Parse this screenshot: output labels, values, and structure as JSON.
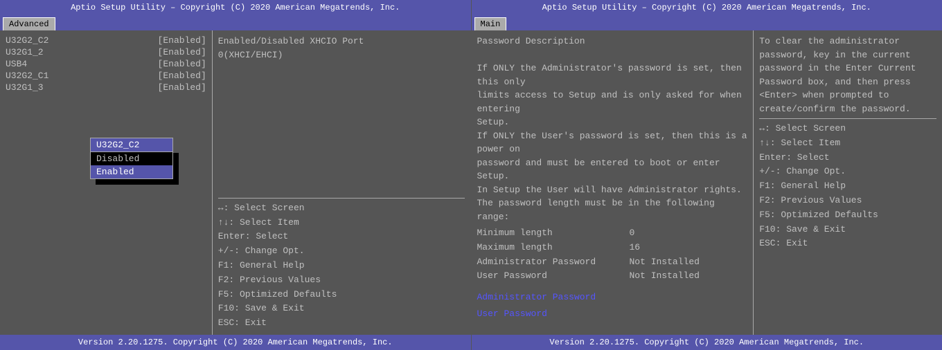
{
  "left_panel": {
    "top_bar": "Aptio Setup Utility – Copyright (C) 2020 American Megatrends, Inc.",
    "active_tab": "Advanced",
    "tabs": [
      "Advanced"
    ],
    "menu_items": [
      {
        "name": "U32G2_C2",
        "value": "[Enabled]"
      },
      {
        "name": "U32G1_2",
        "value": "[Enabled]"
      },
      {
        "name": "USB4",
        "value": "[Enabled]"
      },
      {
        "name": "U32G2_C1",
        "value": "[Enabled]"
      },
      {
        "name": "U32G1_3",
        "value": "[Enabled]"
      }
    ],
    "dropdown": {
      "title": "U32G2_C2",
      "options": [
        "Disabled",
        "Enabled"
      ],
      "selected": "Enabled"
    },
    "help_text": "Enabled/Disabled XHCIO Port\n0(XHCI/EHCI)",
    "key_help": [
      "↔: Select Screen",
      "↑↓: Select Item",
      "Enter: Select",
      "+/-: Change Opt.",
      "F1: General Help",
      "F2: Previous Values",
      "F5: Optimized Defaults",
      "F10: Save & Exit",
      "ESC: Exit"
    ],
    "bottom_bar": "Version 2.20.1275. Copyright (C) 2020 American Megatrends, Inc."
  },
  "right_panel": {
    "top_bar": "Aptio Setup Utility – Copyright (C) 2020 American Megatrends, Inc.",
    "active_tab": "Main",
    "tabs": [
      "Main"
    ],
    "password_description": [
      "Password Description",
      "",
      "If ONLY the Administrator's password is set, then this only",
      "limits access to Setup and is only asked for when entering",
      "Setup.",
      "If ONLY the User's password is set, then this is a power on",
      "password and must be entered to boot or enter Setup.",
      "In Setup the User will have Administrator rights.",
      "The password length must be in the following range:"
    ],
    "info_rows": [
      {
        "label": "Minimum length",
        "value": "0"
      },
      {
        "label": "Maximum length",
        "value": "16"
      },
      {
        "label": "Administrator Password",
        "value": "Not Installed"
      },
      {
        "label": "User Password",
        "value": "Not Installed"
      }
    ],
    "clickable_items": [
      "Administrator Password",
      "User Password"
    ],
    "help_text": "To clear the administrator\npassword, key in the current\npassword in the Enter Current\nPassword box, and then press\n<Enter> when prompted to\ncreate/confirm the password.",
    "key_help": [
      "↔: Select Screen",
      "↑↓: Select Item",
      "Enter: Select",
      "+/-: Change Opt.",
      "F1: General Help",
      "F2: Previous Values",
      "F5: Optimized Defaults",
      "F10: Save & Exit",
      "ESC: Exit"
    ],
    "bottom_bar": "Version 2.20.1275. Copyright (C) 2020 American Megatrends, Inc."
  }
}
